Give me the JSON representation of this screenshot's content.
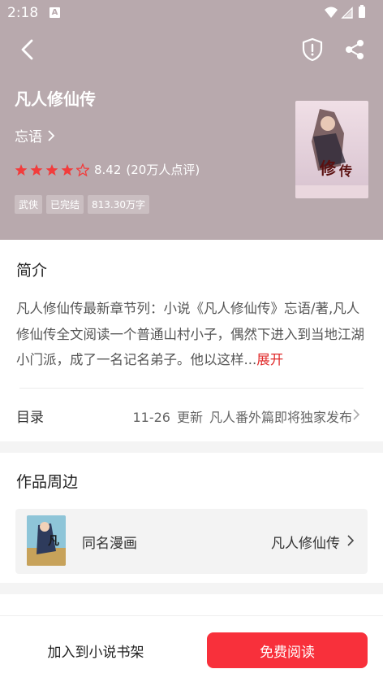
{
  "status_bar": {
    "time": "2:18",
    "notification_letter": "A"
  },
  "book": {
    "title": "凡人修仙传",
    "author": "忘语",
    "rating_score": "8.42",
    "rating_count": "(20万人点评)",
    "stars_filled": 4,
    "stars_total": 5,
    "tags": [
      "武侠",
      "已完结",
      "813.30万字"
    ]
  },
  "intro": {
    "heading": "简介",
    "text": "凡人修仙传最新章节列：小说《凡人修仙传》忘语/著,凡人修仙传全文阅读一个普通山村小子，偶然下进入到当地江湖小门派，成了一名记名弟子。他以这样...",
    "expand_label": "展开"
  },
  "toc": {
    "label": "目录",
    "date": "11-26",
    "update_label": "更新",
    "latest_chapter": "凡人番外篇即将独家发布"
  },
  "related": {
    "heading": "作品周边",
    "item_label": "同名漫画",
    "item_name": "凡人修仙传"
  },
  "bottom": {
    "shelf_label": "加入到小说书架",
    "read_label": "免费阅读"
  },
  "colors": {
    "header_bg": "#b8a9ad",
    "accent": "#f8303b",
    "star": "#f23c3c"
  }
}
